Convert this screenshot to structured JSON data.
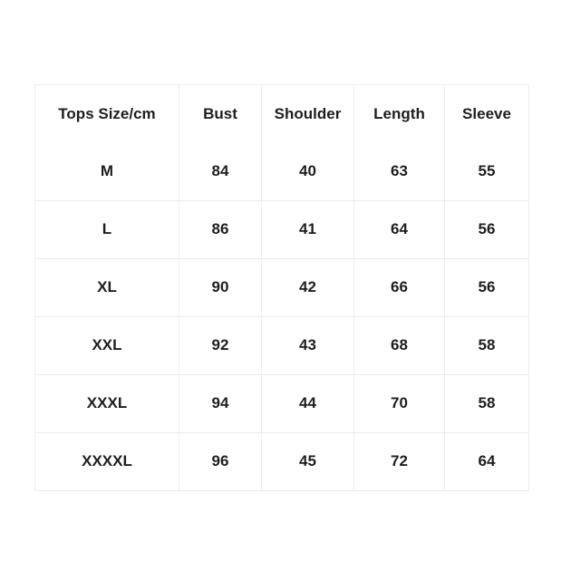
{
  "table": {
    "title_cell": "Tops Size/cm",
    "columns": [
      "Tops Size/cm",
      "Bust",
      "Shoulder",
      "Length",
      "Sleeve"
    ],
    "rows": [
      {
        "size": "M",
        "bust": "84",
        "shoulder": "40",
        "length": "63",
        "sleeve": "55"
      },
      {
        "size": "L",
        "bust": "86",
        "shoulder": "41",
        "length": "64",
        "sleeve": "56"
      },
      {
        "size": "XL",
        "bust": "90",
        "shoulder": "42",
        "length": "66",
        "sleeve": "56"
      },
      {
        "size": "XXL",
        "bust": "92",
        "shoulder": "43",
        "length": "68",
        "sleeve": "58"
      },
      {
        "size": "XXXL",
        "bust": "94",
        "shoulder": "44",
        "length": "70",
        "sleeve": "58"
      },
      {
        "size": "XXXXL",
        "bust": "96",
        "shoulder": "45",
        "length": "72",
        "sleeve": "64"
      }
    ]
  },
  "colors": {
    "background": "#ffffff",
    "text": "#1e1e1e",
    "border": "#ececec"
  }
}
